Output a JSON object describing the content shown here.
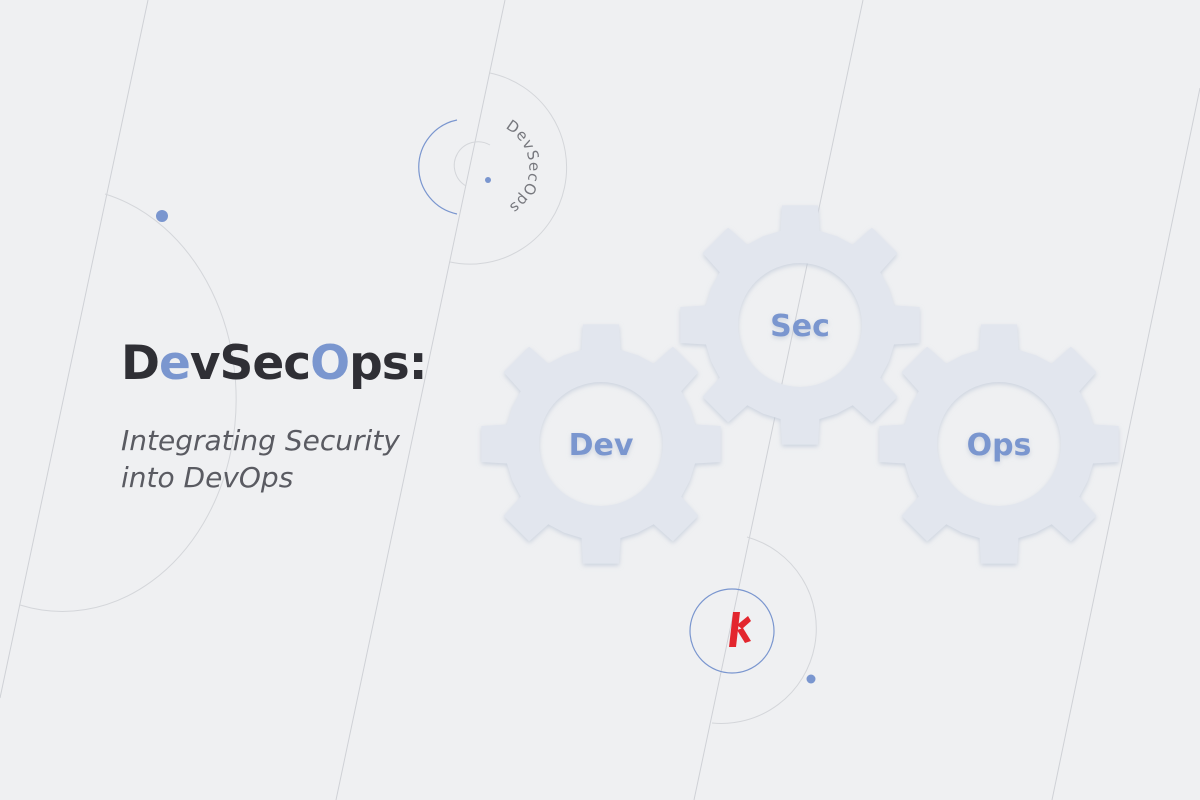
{
  "headline": {
    "parts": [
      "D",
      "e",
      "vSec",
      "O",
      "ps:"
    ]
  },
  "subtitle": {
    "line1": "Integrating Security",
    "line2": "into DevOps"
  },
  "gears": {
    "dev": "Dev",
    "sec": "Sec",
    "ops": "Ops"
  },
  "badge": {
    "arc_text": "DevSecOps"
  },
  "colors": {
    "background": "#eff0f2",
    "accent": "#7a96cf",
    "title": "#2f2f35",
    "gear": "#e2e6ee",
    "brand_red": "#e3262e"
  },
  "icons": [
    "logo-mark-icon"
  ]
}
